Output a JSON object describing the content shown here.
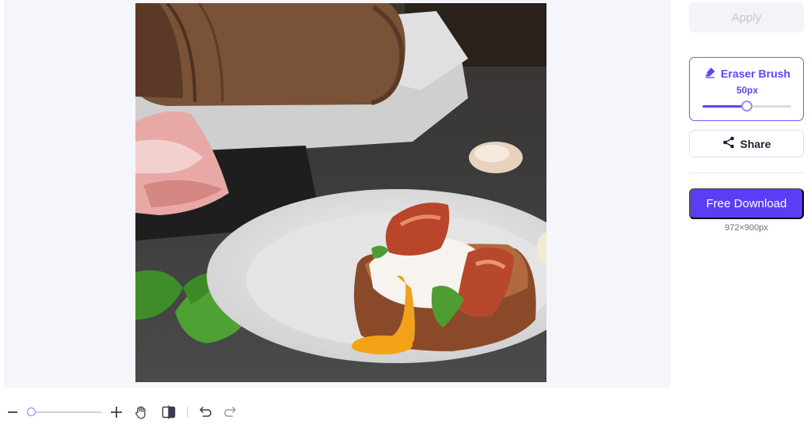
{
  "sidebar": {
    "apply_label": "Apply",
    "brush": {
      "title": "Eraser Brush",
      "size_label": "50px",
      "size_fraction": 0.5,
      "icon": "eraser-icon"
    },
    "share_label": "Share",
    "share_icon": "share-icon",
    "download_label": "Free Download",
    "dimensions": "972×900px"
  },
  "toolbar": {
    "zoom_fraction": 0.0,
    "icons": [
      "zoom-out-icon",
      "zoom-in-icon",
      "hand-pan-icon",
      "compare-icon",
      "undo-icon",
      "redo-icon"
    ]
  },
  "colors": {
    "accent": "#5b3df5",
    "brush_accent": "#5b47f5",
    "apply_disabled_bg": "#f3f4f8",
    "apply_disabled_text": "#c4c7d4",
    "canvas_bg": "#f4f6fb"
  }
}
